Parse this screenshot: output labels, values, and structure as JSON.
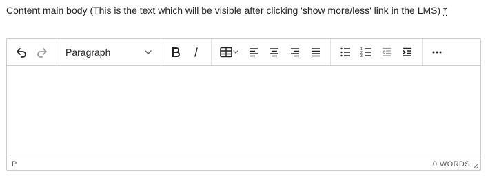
{
  "field": {
    "label": "Content main body (This is the text which will be visible after clicking 'show more/less' link in the LMS)",
    "required_marker": "*"
  },
  "toolbar": {
    "undo_icon": "undo-icon",
    "redo_icon": "redo-icon",
    "format_value": "Paragraph",
    "bold_icon": "bold-icon",
    "italic_icon": "italic-icon",
    "table_icon": "table-icon",
    "align_left_icon": "align-left-icon",
    "align_center_icon": "align-center-icon",
    "align_right_icon": "align-right-icon",
    "align_justify_icon": "align-justify-icon",
    "bullet_list_icon": "bullet-list-icon",
    "numbered_list_icon": "numbered-list-icon",
    "outdent_icon": "outdent-icon",
    "indent_icon": "indent-icon",
    "more_icon": "more-icon"
  },
  "statusbar": {
    "path": "P",
    "word_count": "0 WORDS"
  },
  "colors": {
    "border": "#cccccc",
    "icon": "#222222",
    "icon_disabled": "#999999"
  }
}
